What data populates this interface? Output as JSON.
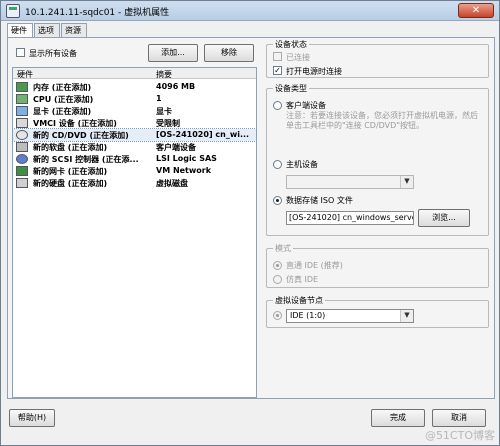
{
  "window": {
    "title": "10.1.241.11-sqdc01 - 虚拟机属性",
    "close_label": "✕"
  },
  "tabs": [
    {
      "label": "硬件"
    },
    {
      "label": "选项"
    },
    {
      "label": "资源"
    }
  ],
  "left": {
    "show_all_devices_label": "显示所有设备",
    "add_button": "添加...",
    "remove_button": "移除",
    "columns": {
      "hardware": "硬件",
      "summary": "摘要"
    },
    "rows": [
      {
        "name": "内存 (正在添加)",
        "summary": "4096 MB",
        "icon": "memory-icon"
      },
      {
        "name": "CPU (正在添加)",
        "summary": "1",
        "icon": "cpu-icon"
      },
      {
        "name": "显卡 (正在添加)",
        "summary": "显卡",
        "icon": "display-icon"
      },
      {
        "name": "VMCI 设备 (正在添加)",
        "summary": "受限制",
        "icon": "vmci-icon"
      },
      {
        "name": "新的 CD/DVD (正在添加)",
        "summary": "[OS-241020] cn_wi...",
        "icon": "cdrom-icon"
      },
      {
        "name": "新的软盘 (正在添加)",
        "summary": "客户端设备",
        "icon": "floppy-icon"
      },
      {
        "name": "新的 SCSI 控制器 (正在添...",
        "summary": "LSI Logic SAS",
        "icon": "scsi-icon"
      },
      {
        "name": "新的网卡 (正在添加)",
        "summary": "VM Network",
        "icon": "nic-icon"
      },
      {
        "name": "新的硬盘 (正在添加)",
        "summary": "虚拟磁盘",
        "icon": "disk-icon"
      }
    ],
    "selected_index": 4
  },
  "device_status": {
    "title": "设备状态",
    "connected_label": "已连接",
    "connect_at_power_on_label": "打开电源时连接"
  },
  "device_type": {
    "title": "设备类型",
    "client_device_label": "客户端设备",
    "client_note": "注意：若要连接该设备，您必须打开虚拟机电源，然后单击工具栏中的\"连接 CD/DVD\"按钮。",
    "host_device_label": "主机设备",
    "host_device_value": "",
    "datastore_iso_label": "数据存储 ISO 文件",
    "iso_path": "[OS-241020] cn_windows_server_20",
    "browse_button": "浏览..."
  },
  "mode": {
    "title": "模式",
    "passthrough_label": "直通 IDE (推荐)",
    "emulate_label": "仿真 IDE"
  },
  "virtual_node": {
    "title": "虚拟设备节点",
    "value": "IDE (1:0)"
  },
  "footer": {
    "help_button": "帮助(H)",
    "finish_button": "完成",
    "cancel_button": "取消"
  },
  "watermark": "@51CTO博客"
}
